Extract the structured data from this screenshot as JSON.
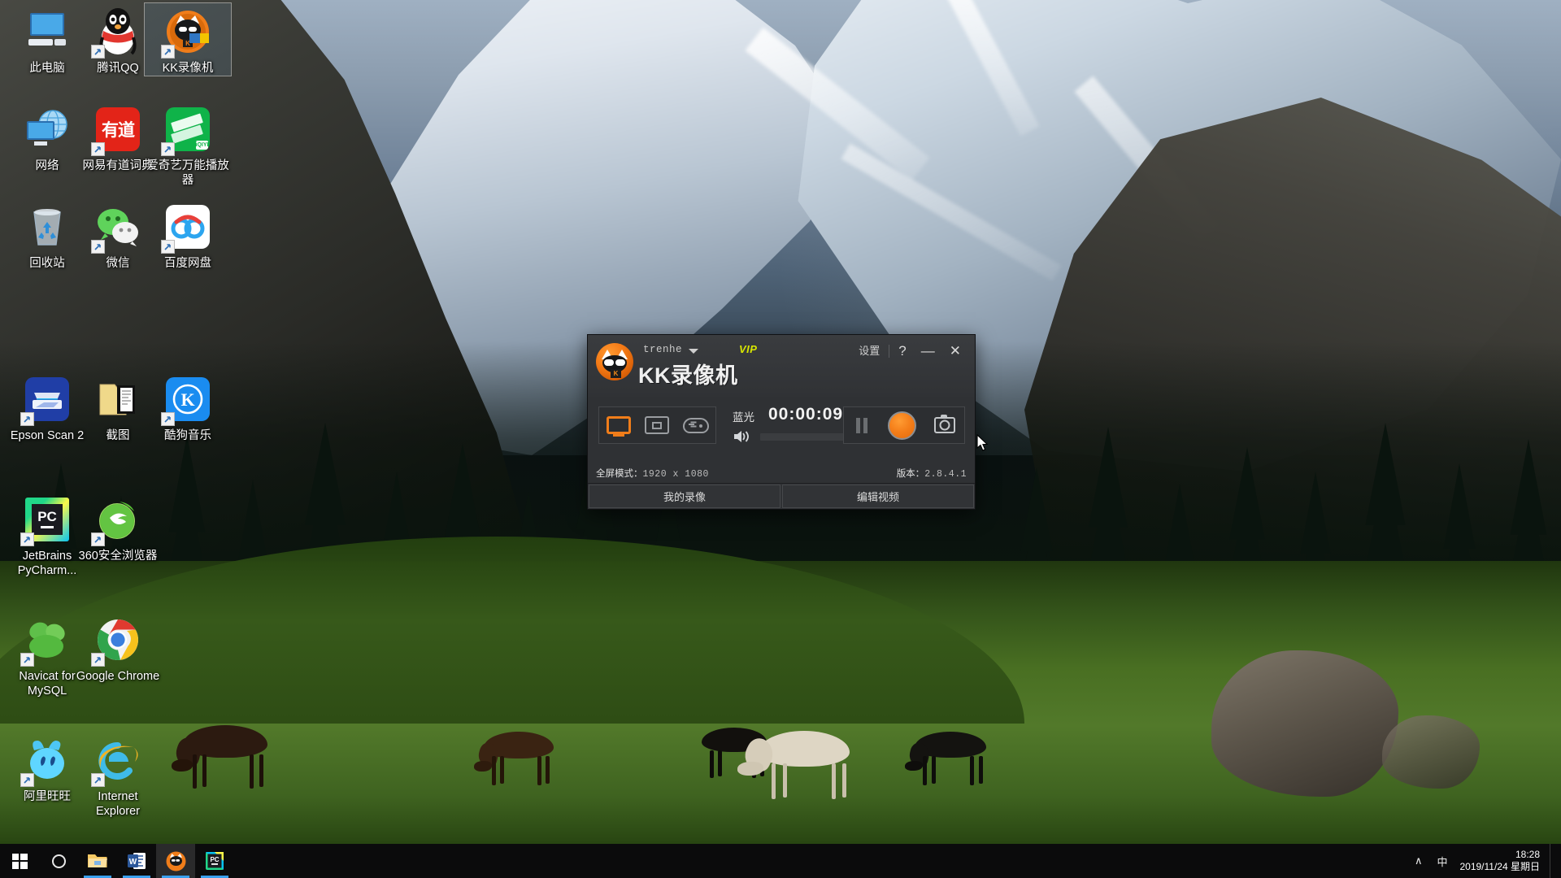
{
  "desktop": {
    "icons": [
      {
        "label": "此电脑",
        "icon": "this-pc-icon",
        "shortcut": false,
        "selected": false
      },
      {
        "label": "腾讯QQ",
        "icon": "tencent-qq-icon",
        "shortcut": true,
        "selected": false
      },
      {
        "label": "KK录像机",
        "icon": "kk-recorder-icon",
        "shortcut": true,
        "selected": true
      },
      {
        "label": "网络",
        "icon": "network-icon",
        "shortcut": false,
        "selected": false
      },
      {
        "label": "网易有道词典",
        "icon": "youdao-dict-icon",
        "shortcut": true,
        "selected": false
      },
      {
        "label": "爱奇艺万能播放器",
        "icon": "iqiyi-player-icon",
        "shortcut": true,
        "selected": false
      },
      {
        "label": "回收站",
        "icon": "recycle-bin-icon",
        "shortcut": false,
        "selected": false
      },
      {
        "label": "微信",
        "icon": "wechat-icon",
        "shortcut": true,
        "selected": false
      },
      {
        "label": "百度网盘",
        "icon": "baidu-netdisk-icon",
        "shortcut": true,
        "selected": false
      },
      {
        "label": "Epson Scan 2",
        "icon": "epson-scan-icon",
        "shortcut": true,
        "selected": false
      },
      {
        "label": "截图",
        "icon": "screenshot-folder-icon",
        "shortcut": false,
        "selected": false
      },
      {
        "label": "酷狗音乐",
        "icon": "kugou-music-icon",
        "shortcut": true,
        "selected": false
      },
      {
        "label": "JetBrains PyCharm...",
        "icon": "pycharm-icon",
        "shortcut": true,
        "selected": false
      },
      {
        "label": "360安全浏览器",
        "icon": "360-browser-icon",
        "shortcut": true,
        "selected": false
      },
      {
        "label": "Navicat for MySQL",
        "icon": "navicat-icon",
        "shortcut": true,
        "selected": false
      },
      {
        "label": "Google Chrome",
        "icon": "google-chrome-icon",
        "shortcut": true,
        "selected": false
      },
      {
        "label": "阿里旺旺",
        "icon": "aliwangwang-icon",
        "shortcut": true,
        "selected": false
      },
      {
        "label": "Internet Explorer",
        "icon": "internet-explorer-icon",
        "shortcut": true,
        "selected": false
      }
    ]
  },
  "kk_window": {
    "username": "trenhe",
    "vip_badge": "VIP",
    "app_name": "KK录像机",
    "settings_label": "设置",
    "help_label": "?",
    "minimize_label": "—",
    "close_label": "✕",
    "modes": [
      {
        "name": "fullscreen",
        "active": true
      },
      {
        "name": "region",
        "active": false
      },
      {
        "name": "game",
        "active": false
      }
    ],
    "quality_label": "蓝光",
    "timer": "00:00:09",
    "status": {
      "mode_label": "全屏模式：",
      "mode_value": "1920 x 1080",
      "version_label": "版本：",
      "version_value": "2.8.4.1"
    },
    "footer": {
      "my_recordings": "我的录像",
      "edit_video": "编辑视频"
    },
    "accent_color": "#f2801a",
    "vip_color": "#d8e600"
  },
  "taskbar": {
    "start_label": "start-button",
    "cortana_label": "cortana-button",
    "apps": [
      {
        "name": "file-explorer",
        "running": true,
        "active": false
      },
      {
        "name": "microsoft-word",
        "running": true,
        "active": false
      },
      {
        "name": "kk-recorder",
        "running": true,
        "active": true
      },
      {
        "name": "pycharm",
        "running": true,
        "active": false
      }
    ],
    "tray": [
      {
        "name": "show-hidden-icons",
        "glyph": "∧"
      },
      {
        "name": "ime-indicator",
        "glyph": "中"
      }
    ],
    "clock": {
      "time": "18:28",
      "date": "2019/11/24 星期日"
    }
  }
}
